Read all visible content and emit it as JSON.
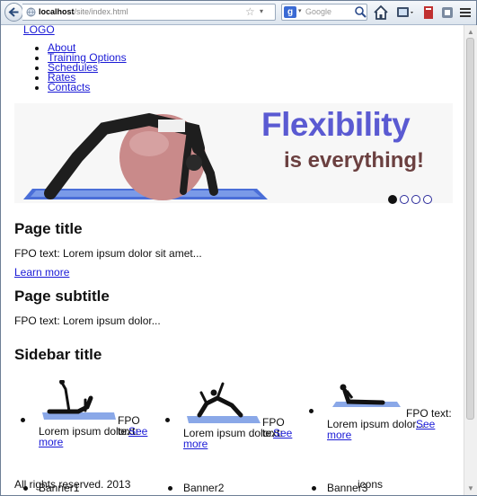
{
  "browser": {
    "url_host": "localhost",
    "url_path": "/site/index.html",
    "search_engine_letter": "g",
    "search_placeholder": "Google",
    "icons": [
      "back-arrow-icon",
      "globe-icon",
      "bookmark-star-icon",
      "url-dropdown-icon",
      "refresh-icon",
      "search-engine-icon",
      "magnifier-icon",
      "home-icon",
      "screenshot-menu-icon",
      "bookmarks-menu-icon",
      "addon-icon",
      "menu-icon"
    ]
  },
  "site": {
    "logo": "LOGO",
    "nav": [
      "About",
      "Training Options",
      "Schedules",
      "Rates",
      "Contacts"
    ],
    "hero": {
      "headline": "Flexibility",
      "subhead": "is everything!",
      "slides_total": 4,
      "active_slide": 1,
      "headline_color": "#5a5ad2",
      "subhead_color": "#6b4040"
    },
    "page_title": "Page title",
    "page_text": "FPO text: Lorem ipsum dolor sit amet...",
    "learn_more": "Learn more",
    "page_subtitle": "Page subtitle",
    "subtitle_text": "FPO text: Lorem ipsum dolor...",
    "sidebar_title": "Sidebar title",
    "banners": [
      {
        "label": "Banner1",
        "text_a": "FPO text:",
        "text_b": "Lorem ipsum dolor...",
        "link_a": "See",
        "link_b": "more"
      },
      {
        "label": "Banner2",
        "text_a": "FPO text:",
        "text_b": "Lorem ipsum dolor...",
        "link_a": "See",
        "link_b": "more"
      },
      {
        "label": "Banner3",
        "text_a": "FPO text:",
        "text_b": "Lorem ipsum dolor...",
        "link_a": "See",
        "link_b": "more"
      }
    ],
    "footer_copyright": "All rights reserved. 2013",
    "footer_icons": "icons",
    "link_color": "#1a1ad6"
  }
}
